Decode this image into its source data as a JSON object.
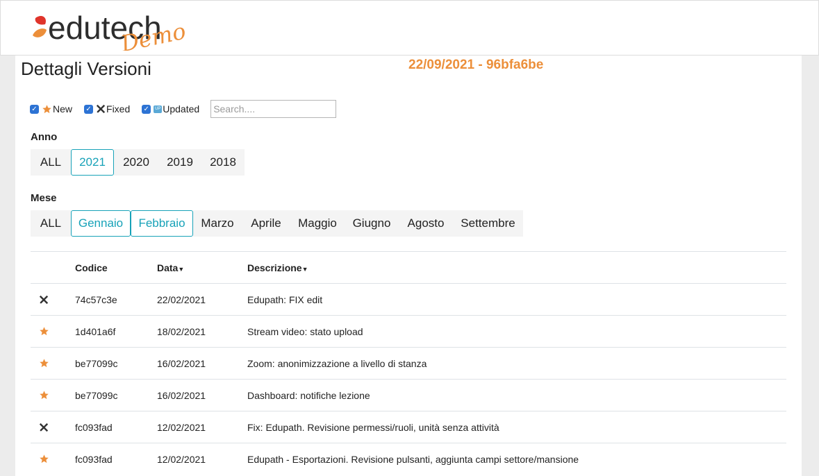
{
  "header": {
    "logo_text": "edutech",
    "logo_badge": "Demo"
  },
  "page": {
    "title": "Dettagli Versioni",
    "version": "22/09/2021 - 96bfa6be"
  },
  "filters": {
    "new_label": "New",
    "fixed_label": "Fixed",
    "updated_label": "Updated",
    "search_placeholder": "Search...."
  },
  "anno": {
    "label": "Anno",
    "options": [
      "ALL",
      "2021",
      "2020",
      "2019",
      "2018"
    ],
    "selected": [
      "2021"
    ]
  },
  "mese": {
    "label": "Mese",
    "options": [
      "ALL",
      "Gennaio",
      "Febbraio",
      "Marzo",
      "Aprile",
      "Maggio",
      "Giugno",
      "Agosto",
      "Settembre"
    ],
    "selected": [
      "Gennaio",
      "Febbraio"
    ]
  },
  "table": {
    "headers": {
      "codice": "Codice",
      "data": "Data",
      "descrizione": "Descrizione"
    },
    "rows": [
      {
        "type": "fixed",
        "codice": "74c57c3e",
        "data": "22/02/2021",
        "descrizione": "Edupath: FIX edit"
      },
      {
        "type": "new",
        "codice": "1d401a6f",
        "data": "18/02/2021",
        "descrizione": "Stream video: stato upload"
      },
      {
        "type": "new",
        "codice": "be77099c",
        "data": "16/02/2021",
        "descrizione": "Zoom: anonimizzazione a livello di stanza"
      },
      {
        "type": "new",
        "codice": "be77099c",
        "data": "16/02/2021",
        "descrizione": "Dashboard: notifiche lezione"
      },
      {
        "type": "fixed",
        "codice": "fc093fad",
        "data": "12/02/2021",
        "descrizione": "Fix: Edupath. Revisione permessi/ruoli, unità senza attività"
      },
      {
        "type": "new",
        "codice": "fc093fad",
        "data": "12/02/2021",
        "descrizione": "Edupath - Esportazioni. Revisione pulsanti, aggiunta campi settore/mansione"
      }
    ]
  },
  "colors": {
    "accent": "#17a2b8",
    "version": "#ec8f3a",
    "star": "#ec8f3a",
    "checkbox": "#2d73d4"
  }
}
